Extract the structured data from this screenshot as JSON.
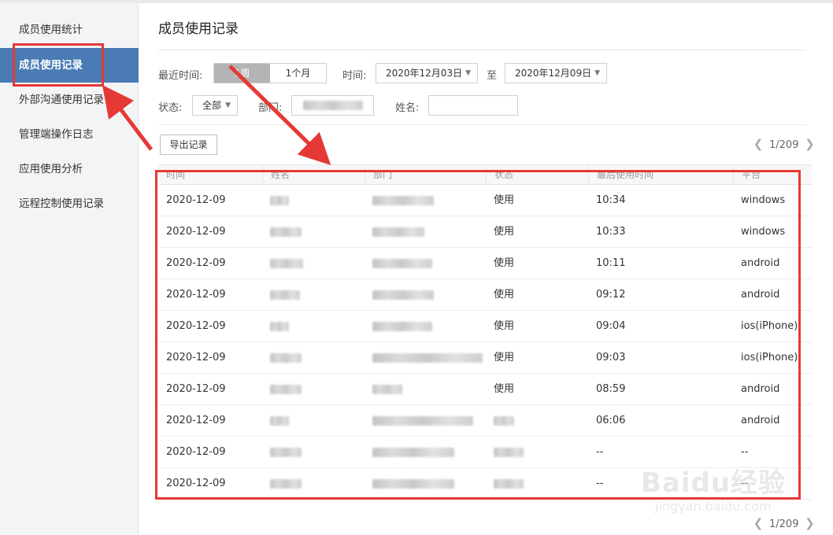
{
  "sidebar": {
    "items": [
      {
        "label": "成员使用统计",
        "active": false
      },
      {
        "label": "成员使用记录",
        "active": true
      },
      {
        "label": "外部沟通使用记录",
        "active": false
      },
      {
        "label": "管理端操作日志",
        "active": false
      },
      {
        "label": "应用使用分析",
        "active": false
      },
      {
        "label": "远程控制使用记录",
        "active": false
      }
    ]
  },
  "main": {
    "title": "成员使用记录",
    "filters": {
      "recent_label": "最近时间:",
      "recent_options": [
        {
          "label": "1周",
          "active": true
        },
        {
          "label": "1个月",
          "active": false
        }
      ],
      "time_label": "时间:",
      "start_date": "2020年12月03日",
      "to_label": "至",
      "end_date": "2020年12月09日",
      "status_label": "状态:",
      "status_value": "全部",
      "dept_label": "部门:",
      "name_label": "姓名:",
      "name_value": ""
    },
    "export_label": "导出记录",
    "pagination": {
      "text": "1/209"
    },
    "table": {
      "columns": [
        "时间",
        "姓名",
        "部门",
        "状态",
        "最后使用时间",
        "平台"
      ],
      "rows": [
        {
          "date": "2020-12-09",
          "status": "使用",
          "last_used": "10:34",
          "platform": "windows"
        },
        {
          "date": "2020-12-09",
          "status": "使用",
          "last_used": "10:33",
          "platform": "windows"
        },
        {
          "date": "2020-12-09",
          "status": "使用",
          "last_used": "10:11",
          "platform": "android"
        },
        {
          "date": "2020-12-09",
          "status": "使用",
          "last_used": "09:12",
          "platform": "android"
        },
        {
          "date": "2020-12-09",
          "status": "使用",
          "last_used": "09:04",
          "platform": "ios(iPhone)"
        },
        {
          "date": "2020-12-09",
          "status": "使用",
          "last_used": "09:03",
          "platform": "ios(iPhone)"
        },
        {
          "date": "2020-12-09",
          "status": "使用",
          "last_used": "08:59",
          "platform": "android"
        },
        {
          "date": "2020-12-09",
          "status": "",
          "last_used": "06:06",
          "platform": "android"
        },
        {
          "date": "2020-12-09",
          "status": "",
          "last_used": "--",
          "platform": "--"
        },
        {
          "date": "2020-12-09",
          "status": "",
          "last_used": "--",
          "platform": "--"
        }
      ]
    }
  },
  "watermark": {
    "brand": "Baidu经验",
    "url": "jingyan.baidu.com"
  },
  "colors": {
    "accent": "#4a7bb5",
    "annotation": "#e53935"
  }
}
